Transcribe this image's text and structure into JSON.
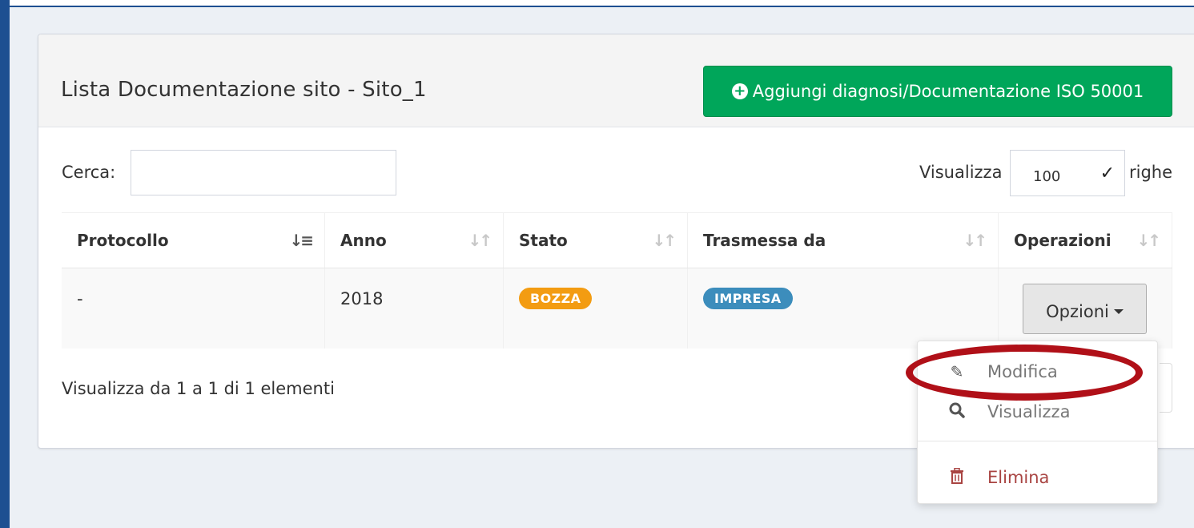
{
  "box": {
    "title": "Lista Documentazione sito - Sito_1",
    "add_button_label": "Aggiungi diagnosi/Documentazione ISO 50001"
  },
  "filters": {
    "search_label": "Cerca:",
    "search_value": "",
    "length_prefix": "Visualizza",
    "length_value": "100",
    "length_suffix": "righe"
  },
  "table": {
    "columns": [
      "Protocollo",
      "Anno",
      "Stato",
      "Trasmessa da",
      "Operazioni"
    ],
    "rows": [
      {
        "protocollo": "-",
        "anno": "2018",
        "stato": "BOZZA",
        "trasmessa_da": "IMPRESA",
        "operazioni_label": "Opzioni"
      }
    ]
  },
  "info_text": "Visualizza da 1 a 1 di 1 elementi",
  "dropdown": {
    "items": [
      "Modifica",
      "Visualizza",
      "Elimina"
    ]
  },
  "colors": {
    "primary_bar": "#1d4f91",
    "success": "#00a65a",
    "badge_bozza": "#f39c12",
    "badge_impresa": "#3c8dbc",
    "danger": "#a94442",
    "highlight": "#b01018"
  },
  "icons": {
    "add": "plus-circle-icon",
    "sort_active": "sort-amount-down-icon",
    "sort": "sort-icon",
    "modifica": "pencil-icon",
    "visualizza": "search-icon",
    "elimina": "trash-icon",
    "length_select": "chevron-down-icon"
  }
}
